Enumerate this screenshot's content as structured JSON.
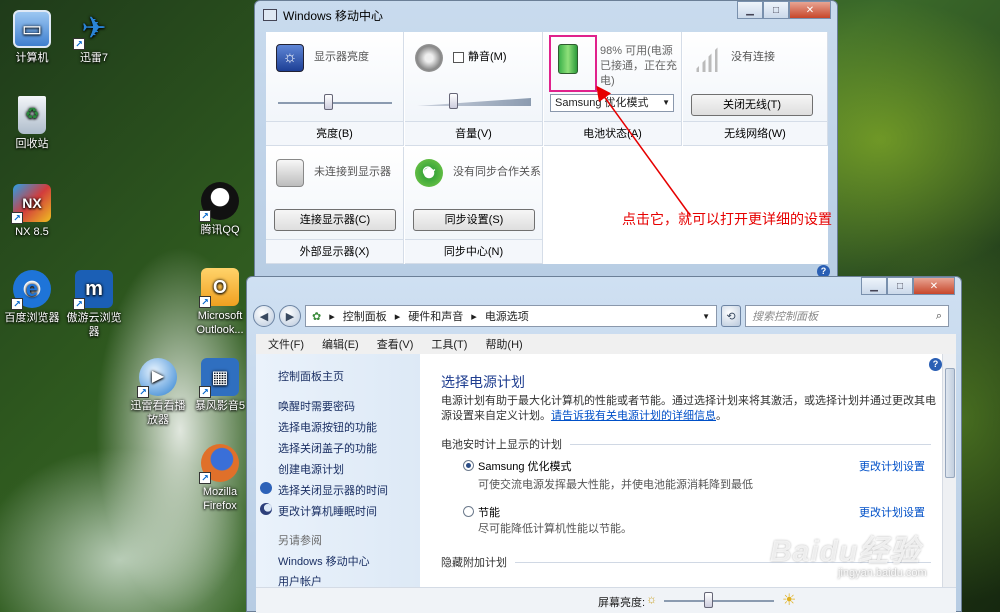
{
  "desktop": {
    "icons": [
      {
        "label": "计算机",
        "icon": "computer-icon",
        "color": "#4f8fd8"
      },
      {
        "label": "迅雷7",
        "icon": "thunder-bird-icon",
        "color": "#2a84d6"
      },
      {
        "label": "回收站",
        "icon": "recycle-bin-icon",
        "color": "#cfd8e2"
      },
      {
        "label": "NX 8.5",
        "icon": "nx-icon",
        "color": "#d23c3c"
      },
      {
        "label": "腾讯QQ",
        "icon": "qq-penguin-icon",
        "color": "#111111"
      },
      {
        "label": "百度浏览器",
        "icon": "baidu-browser-icon",
        "color": "#1e74d8"
      },
      {
        "label": "傲游云浏览器",
        "icon": "maxthon-icon",
        "color": "#1b5fb5"
      },
      {
        "label": "Microsoft Outlook...",
        "icon": "outlook-icon",
        "color": "#f0a020"
      },
      {
        "label": "迅雷看看播放器",
        "icon": "xunlei-kankan-icon",
        "color": "#2b7fd0"
      },
      {
        "label": "暴风影音5",
        "icon": "baofeng-icon",
        "color": "#2f6fc0"
      },
      {
        "label": "Mozilla Firefox",
        "icon": "firefox-icon",
        "color": "#e0702a"
      }
    ]
  },
  "mobility_center": {
    "title": "Windows 移动中心",
    "tiles": {
      "brightness": {
        "text": "显示器亮度",
        "footer": "亮度(B)"
      },
      "volume": {
        "mute_label": "静音(M)",
        "footer": "音量(V)"
      },
      "battery": {
        "status": "98% 可用(电源已接通，正在充电)",
        "plan": "Samsung 优化模式",
        "footer": "电池状态(A)"
      },
      "wireless": {
        "text": "没有连接",
        "button": "关闭无线(T)",
        "footer": "无线网络(W)"
      },
      "display": {
        "text": "未连接到显示器",
        "button": "连接显示器(C)",
        "footer": "外部显示器(X)"
      },
      "sync": {
        "text": "没有同步合作关系",
        "button": "同步设置(S)",
        "footer": "同步中心(N)"
      }
    },
    "help_glyph": "?"
  },
  "annotation": "点击它，就可以打开更详细的设置",
  "power_options": {
    "breadcrumb": [
      "控制面板",
      "硬件和声音",
      "电源选项"
    ],
    "search_placeholder": "搜索控制面板",
    "menu": [
      "文件(F)",
      "编辑(E)",
      "查看(V)",
      "工具(T)",
      "帮助(H)"
    ],
    "sidebar": {
      "home": "控制面板主页",
      "links": [
        "唤醒时需要密码",
        "选择电源按钮的功能",
        "选择关闭盖子的功能",
        "创建电源计划",
        "选择关闭显示器的时间",
        "更改计算机睡眠时间"
      ],
      "see_also": "另请参阅",
      "see_also_links": [
        "Windows 移动中心",
        "用户帐户"
      ]
    },
    "heading": "选择电源计划",
    "description": "电源计划有助于最大化计算机的性能或者节能。通过选择计划来将其激活，或选择计划并通过更改其电源设置来自定义计划。",
    "description_link": "请告诉我有关电源计划的详细信息",
    "section_title": "电池安时计上显示的计划",
    "plans": [
      {
        "name": "Samsung 优化模式",
        "desc": "可使交流电源发挥最大性能，并使电池能源消耗降到最低",
        "selected": true,
        "link": "更改计划设置"
      },
      {
        "name": "节能",
        "desc": "尽可能降低计算机性能以节能。",
        "selected": false,
        "link": "更改计划设置"
      }
    ],
    "hidden_section": "隐藏附加计划",
    "brightness_label": "屏幕亮度:"
  },
  "watermark": {
    "main": "Baidu经验",
    "sub": "jingyan.baidu.com"
  }
}
